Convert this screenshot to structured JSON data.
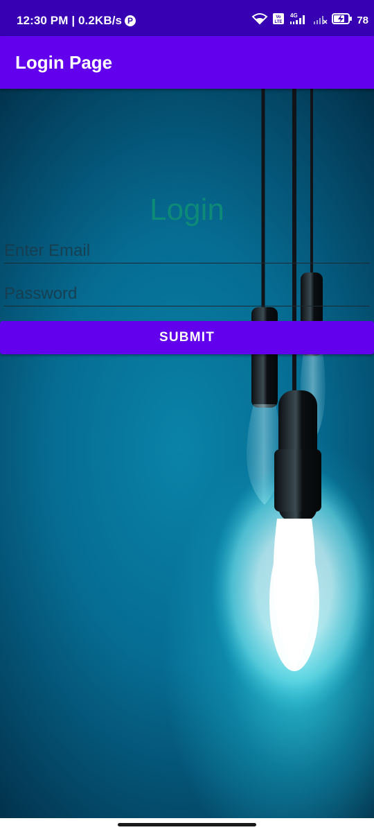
{
  "status_bar": {
    "time_speed": "12:30 PM | 0.2KB/s",
    "p_badge": "P",
    "volte_label": "Vo LTE",
    "network_label": "4G",
    "battery_percent": "78"
  },
  "app_bar": {
    "title": "Login Page"
  },
  "form": {
    "heading": "Login",
    "email_placeholder": "Enter Email",
    "password_placeholder": "Password",
    "submit_label": "SUBMIT"
  }
}
